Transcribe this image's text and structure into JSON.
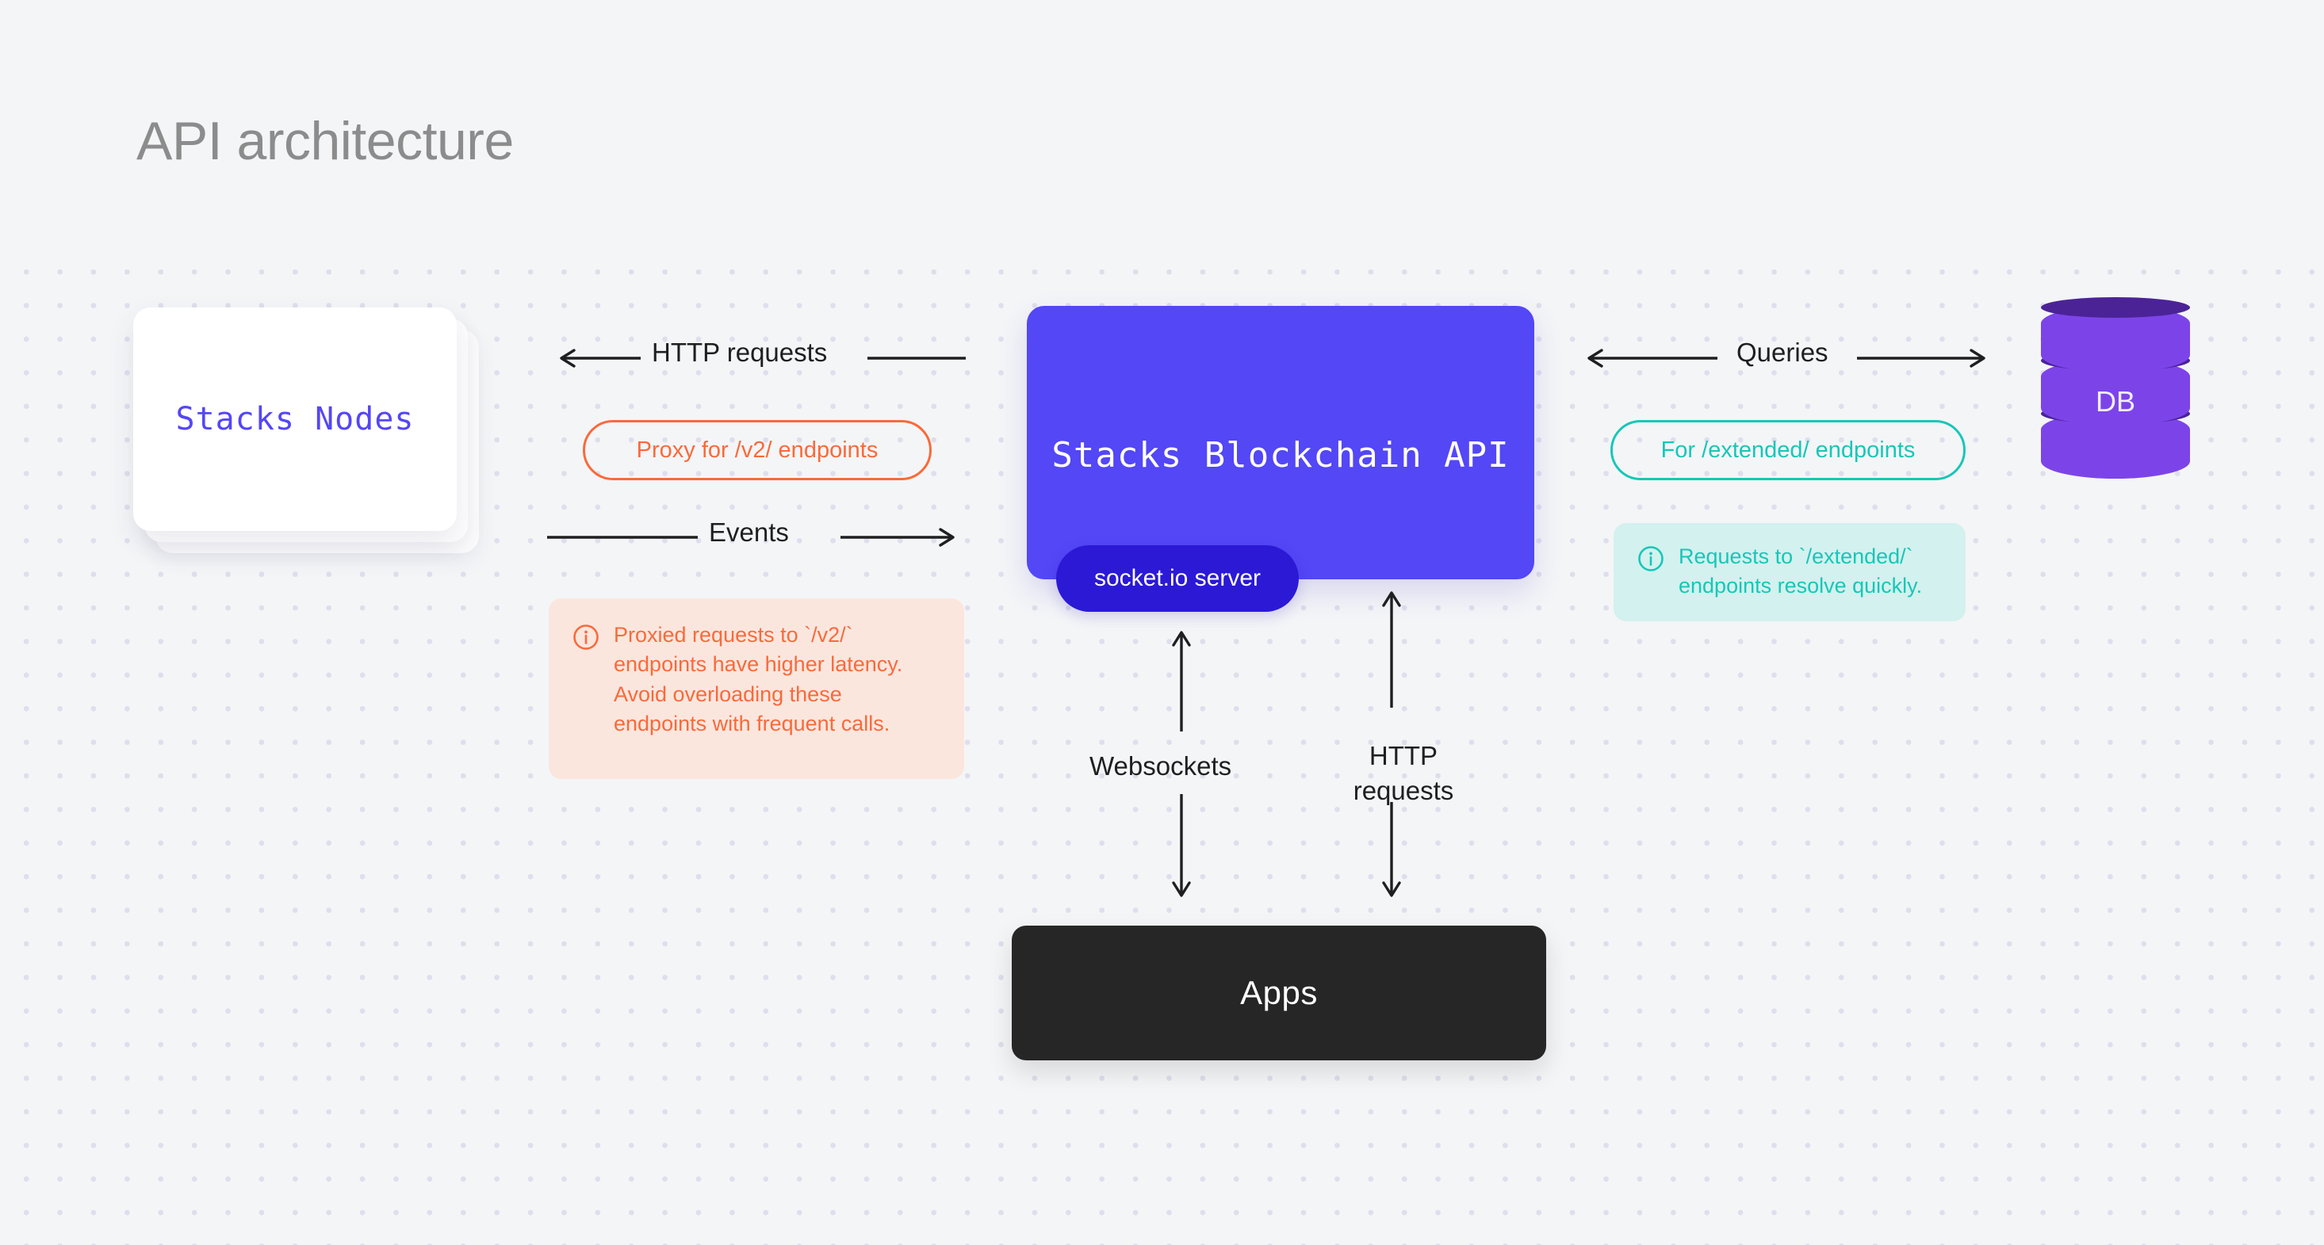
{
  "page": {
    "title": "API architecture",
    "background_color": "#f4f5f7",
    "dot_color": "#dedeec"
  },
  "nodes": {
    "stacks_nodes": {
      "label": "Stacks Nodes",
      "color": "#5546f5",
      "card_color": "#ffffff",
      "card_count": 3
    },
    "api": {
      "label": "Stacks Blockchain API",
      "color": "#5347f6",
      "text_color": "#ffffff"
    },
    "socketio": {
      "label": "socket.io server",
      "color": "#2b19d6",
      "text_color": "#ffffff"
    },
    "apps": {
      "label": "Apps",
      "color": "#262626",
      "text_color": "#ffffff"
    },
    "db": {
      "label": "DB",
      "body_color": "#7c44e8",
      "top_color": "#4b2397"
    }
  },
  "connections": {
    "http_requests_left": {
      "label": "HTTP requests",
      "direction": "left"
    },
    "events": {
      "label": "Events",
      "direction": "right"
    },
    "queries": {
      "label": "Queries",
      "direction": "both"
    },
    "websockets": {
      "label": "Websockets",
      "direction": "both-vertical"
    },
    "http_requests_vertical": {
      "label": "HTTP requests",
      "direction": "both-vertical"
    }
  },
  "badges": {
    "proxy": {
      "label": "Proxy for /v2/ endpoints",
      "color": "#f96a3a"
    },
    "extended": {
      "label": "For /extended/ endpoints",
      "color": "#17c7b8"
    }
  },
  "callouts": {
    "warning": {
      "icon": "info-circle-icon",
      "text": "Proxied requests to `/v2/` endpoints have higher latency. Avoid overloading these endpoints with frequent calls.",
      "text_color": "#f96a3a",
      "background_color": "#fbe6de"
    },
    "info": {
      "icon": "info-circle-icon",
      "text": "Requests to `/extended/` endpoints resolve quickly.",
      "text_color": "#17c7b8",
      "background_color": "#d3f1ee"
    }
  }
}
